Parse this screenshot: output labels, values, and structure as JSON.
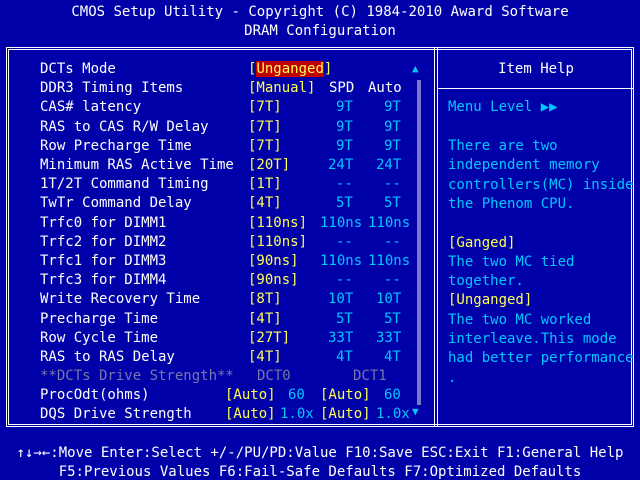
{
  "header": {
    "title": "CMOS Setup Utility - Copyright (C) 1984-2010 Award Software",
    "subtitle": "DRAM Configuration"
  },
  "table": {
    "col_spd": "SPD",
    "col_auto": "Auto",
    "rows": [
      {
        "label": "DCTs Mode",
        "value": "[Unganged]",
        "spd": "",
        "auto": ""
      },
      {
        "label": "DDR3 Timing Items",
        "value": "[Manual]",
        "spd": "",
        "auto": ""
      },
      {
        "label": "CAS# latency",
        "value": "[7T]",
        "spd": "9T",
        "auto": "9T"
      },
      {
        "label": "RAS to CAS R/W Delay",
        "value": "[7T]",
        "spd": "9T",
        "auto": "9T"
      },
      {
        "label": "Row Precharge Time",
        "value": "[7T]",
        "spd": "9T",
        "auto": "9T"
      },
      {
        "label": "Minimum RAS Active Time",
        "value": "[20T]",
        "spd": "24T",
        "auto": "24T"
      },
      {
        "label": "1T/2T Command Timing",
        "value": "[1T]",
        "spd": "--",
        "auto": "--"
      },
      {
        "label": "TwTr Command Delay",
        "value": "[4T]",
        "spd": "5T",
        "auto": "5T"
      },
      {
        "label": "Trfc0 for DIMM1",
        "value": "[110ns]",
        "spd": "110ns",
        "auto": "110ns"
      },
      {
        "label": "Trfc2 for DIMM2",
        "value": "[110ns]",
        "spd": "--",
        "auto": "--"
      },
      {
        "label": "Trfc1 for DIMM3",
        "value": "[90ns]",
        "spd": "110ns",
        "auto": "110ns"
      },
      {
        "label": "Trfc3 for DIMM4",
        "value": "[90ns]",
        "spd": "--",
        "auto": "--"
      },
      {
        "label": "Write Recovery Time",
        "value": "[8T]",
        "spd": "10T",
        "auto": "10T"
      },
      {
        "label": "Precharge Time",
        "value": "[4T]",
        "spd": "5T",
        "auto": "5T"
      },
      {
        "label": "Row Cycle Time",
        "value": "[27T]",
        "spd": "33T",
        "auto": "33T"
      },
      {
        "label": "RAS to RAS Delay",
        "value": "[4T]",
        "spd": "4T",
        "auto": "4T"
      }
    ],
    "drive_strength": {
      "label": "**DCTs Drive Strength**",
      "dct0": "DCT0",
      "dct1": "DCT1"
    },
    "procodt": {
      "label": "ProcOdt(ohms)",
      "v0": "[Auto]",
      "s0": "60",
      "v1": "[Auto]",
      "s1": "60"
    },
    "dqs": {
      "label": "DQS Drive Strength",
      "v0": "[Auto]",
      "s0": "1.0x",
      "v1": "[Auto]",
      "s1": "1.0x"
    }
  },
  "scrollbar": {
    "up": "▲",
    "down": "▼"
  },
  "help": {
    "title": "Item Help",
    "menu_level": "Menu Level   ▶▶",
    "lines": [
      {
        "text": "There are two",
        "color": "cyan"
      },
      {
        "text": "independent memory",
        "color": "cyan"
      },
      {
        "text": "controllers(MC) inside",
        "color": "cyan"
      },
      {
        "text": "the Phenom CPU.",
        "color": "cyan"
      },
      {
        "text": "",
        "color": "cyan"
      },
      {
        "text": "[Ganged]",
        "color": "yellow"
      },
      {
        "text": "The two MC tied",
        "color": "cyan"
      },
      {
        "text": "together.",
        "color": "cyan"
      },
      {
        "text": "[Unganged]",
        "color": "yellow"
      },
      {
        "text": "The two MC worked",
        "color": "cyan"
      },
      {
        "text": "interleave.This mode",
        "color": "cyan"
      },
      {
        "text": "had better performance",
        "color": "cyan"
      },
      {
        "text": ".",
        "color": "cyan"
      }
    ]
  },
  "footer": {
    "line1": "↑↓→←:Move  Enter:Select  +/-/PU/PD:Value  F10:Save  ESC:Exit  F1:General Help",
    "line2": "F5:Previous Values  F6:Fail-Safe Defaults  F7:Optimized Defaults"
  },
  "colors": {
    "background": "#0000a8",
    "selection": "#c00000",
    "value": "#ffff55",
    "info": "#00c8ff"
  }
}
